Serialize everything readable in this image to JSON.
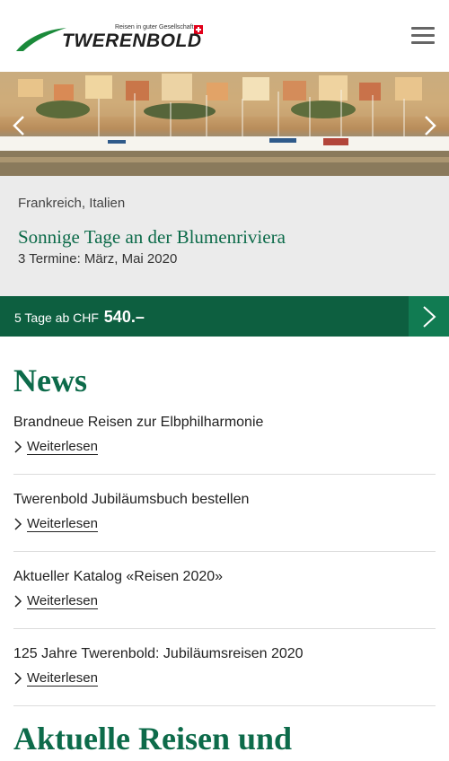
{
  "header": {
    "logo_text": "TWERENBOLD",
    "logo_tagline": "Reisen in guter Gesellschaft",
    "menu_icon": "hamburger-menu-icon"
  },
  "hero": {
    "image": "harbor-with-boats-and-colorful-houses",
    "prev_icon": "chevron-left-icon",
    "next_icon": "chevron-right-icon"
  },
  "trip": {
    "countries": "Frankreich, Italien",
    "title": "Sonnige Tage an der Blumenriviera",
    "dates": "3 Termine: März, Mai 2020"
  },
  "price": {
    "prefix": "5 Tage ab CHF",
    "amount": "540.–",
    "arrow_icon": "chevron-right-icon"
  },
  "news": {
    "heading": "News",
    "items": [
      {
        "title": "Brandneue Reisen zur Elbphilharmonie",
        "link": "Weiterlesen"
      },
      {
        "title": "Twerenbold Jubiläumsbuch bestellen",
        "link": "Weiterlesen"
      },
      {
        "title": "Aktueller Katalog «Reisen 2020»",
        "link": "Weiterlesen"
      },
      {
        "title": "125 Jahre Twerenbold: Jubiläumsreisen 2020",
        "link": "Weiterlesen"
      }
    ]
  },
  "section": {
    "heading": "Aktuelle Reisen und"
  },
  "colors": {
    "brand_green": "#0d6b4a",
    "price_bar": "#0d5f40",
    "price_arrow": "#117b52",
    "trip_bg": "#ebebeb",
    "swiss_red": "#e2001a"
  }
}
